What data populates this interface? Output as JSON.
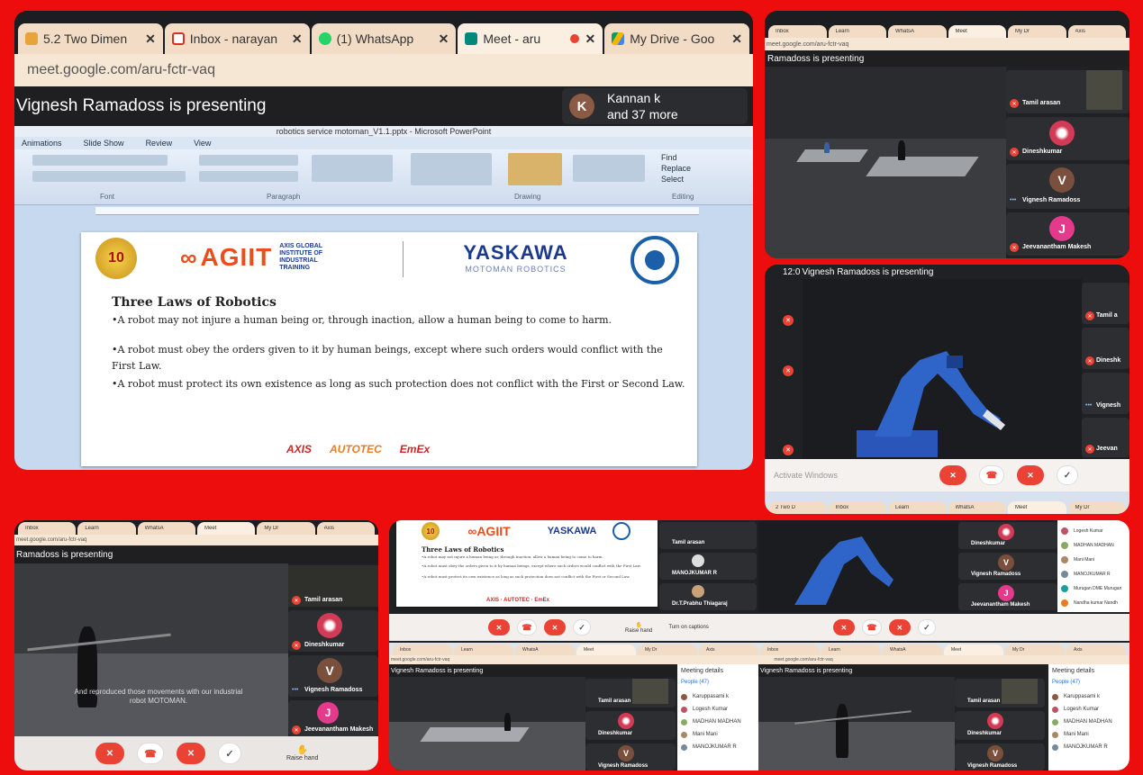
{
  "colors": {
    "frame": "#ee0d0d",
    "meet_dark": "#202124",
    "end_call": "#ea4335",
    "avatar_v": "#7a4f3c",
    "avatar_j": "#e5398b",
    "avatar_k": "#8a5a44",
    "robot_blue": "#2956b8"
  },
  "main": {
    "tabs": [
      {
        "label": "5.2 Two Dimen",
        "icon": "doc-icon"
      },
      {
        "label": "Inbox - narayan",
        "icon": "gmail-icon"
      },
      {
        "label": "(1) WhatsApp",
        "icon": "whatsapp-icon"
      },
      {
        "label": "Meet - aru",
        "icon": "meet-icon",
        "active": true
      },
      {
        "label": "My Drive - Goo",
        "icon": "drive-icon"
      }
    ],
    "url": "meet.google.com/aru-fctr-vaq",
    "presenting": "Vignesh Ramadoss is presenting",
    "viewer_avatar": "K",
    "viewer_name": "Kannan k",
    "viewer_more": "and 37 more",
    "ppt_title": "robotics service motoman_V1.1.pptx - Microsoft PowerPoint",
    "ppt_menu": [
      "Animations",
      "Slide Show",
      "Review",
      "View"
    ],
    "ppt_groups": [
      "Font",
      "Paragraph",
      "Drawing",
      "Editing"
    ],
    "ppt_editing": [
      "Find",
      "Replace",
      "Select"
    ],
    "slide": {
      "badge": "10",
      "logo_agiit": "AGIIT",
      "logo_agiit_sub": [
        "AXIS GLOBAL",
        "INSTITUTE OF",
        "INDUSTRIAL",
        "TRAINING"
      ],
      "logo_yaskawa": "YASKAWA",
      "logo_yaskawa_sub": "MOTOMAN ROBOTICS",
      "heading": "Three Laws of Robotics",
      "law1": "•A robot may not injure a human being or, through inaction, allow a human being to come to harm.",
      "law2": "•A robot must obey the orders given to it by human beings, except where such orders would conflict with the First Law.",
      "law3": "•A robot must protect its own existence as long as such protection does not conflict with the First or Second Law.",
      "footer_logos": [
        "AXIS",
        "AUTOTEC",
        "EmEx"
      ]
    }
  },
  "shot_tr": {
    "url": "meet.google.com/aru-fctr-vaq",
    "presenting": "Ramadoss is presenting",
    "participants": [
      {
        "name": "Tamil arasan",
        "avatar": ""
      },
      {
        "name": "Dineshkumar",
        "avatar": ""
      },
      {
        "name": "Vignesh Ramadoss",
        "avatar": "V"
      },
      {
        "name": "Jeevanantham Makesh",
        "avatar": "J"
      }
    ]
  },
  "shot_mr": {
    "time": "12:0",
    "presenting": "Vignesh Ramadoss is presenting",
    "participants": [
      "Tamil a",
      "Dineshk",
      "Vignesh",
      "Jeevan"
    ],
    "taskbar_tabs": [
      "2 Two D",
      "Inbox",
      "Learn",
      "WhatsA",
      "Meet",
      "My Dr"
    ],
    "win_text": "Activate Windows"
  },
  "shot_bl": {
    "url": "meet.google.com/aru-fctr-vaq",
    "presenting": "Ramadoss is presenting",
    "caption": "And reproduced those movements with our industrial robot MOTOMAN.",
    "participants": [
      {
        "name": "Tamil arasan",
        "avatar": ""
      },
      {
        "name": "Dineshkumar",
        "avatar": ""
      },
      {
        "name": "Vignesh Ramadoss",
        "avatar": "V"
      },
      {
        "name": "Jeevanantham Makesh",
        "avatar": "J"
      }
    ],
    "raise": "Raise hand"
  },
  "shot_br_top": {
    "participants_left": [
      "Tamil arasan",
      "MANOJKUMAR R",
      "Dr.T.Prabhu Thiagaraj"
    ],
    "participants_right": [
      "Dineshkumar",
      "Vignesh Ramadoss",
      "Jeevanantham Makesh"
    ],
    "people": [
      "Logesh Kumar",
      "MADHAN MADHAN",
      "Mani Mani",
      "MANOJKUMAR R",
      "Murugan DME Murugan",
      "Nandha kumar Nandh"
    ],
    "raise": "Raise hand",
    "captions": "Turn on captions"
  },
  "shot_br_bot": {
    "presenting": "Vignesh Ramadoss is presenting",
    "details": "Meeting details",
    "people_tab": "People (47)",
    "people": [
      "Karuppasami k",
      "Logesh Kumar",
      "MADHAN MADHAN",
      "Mani Mani",
      "MANOJKUMAR R"
    ],
    "tile_names": [
      "Tamil arasan",
      "Dineshkumar",
      "Vignesh Ramadoss"
    ]
  }
}
